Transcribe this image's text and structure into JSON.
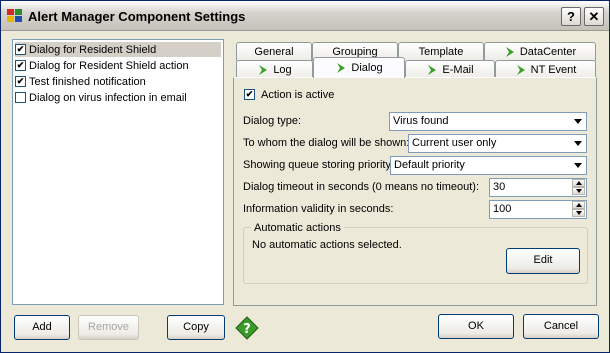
{
  "window": {
    "title": "Alert Manager Component Settings",
    "help_glyph": "?",
    "close_glyph": "✕"
  },
  "left_list": {
    "items": [
      {
        "label": "Dialog for Resident Shield",
        "checked": true,
        "selected": true
      },
      {
        "label": "Dialog for Resident Shield action",
        "checked": true,
        "selected": false
      },
      {
        "label": "Test finished notification",
        "checked": true,
        "selected": false
      },
      {
        "label": "Dialog on virus infection in email",
        "checked": false,
        "selected": false
      }
    ]
  },
  "left_buttons": {
    "add": "Add",
    "remove": "Remove",
    "copy": "Copy"
  },
  "tabs": {
    "row1": [
      "General",
      "Grouping",
      "Template",
      "DataCenter"
    ],
    "row2": [
      "Log",
      "Dialog",
      "E-Mail",
      "NT Event"
    ],
    "active": "Dialog"
  },
  "dialog_tab": {
    "action_active_label": "Action is active",
    "action_active_checked": true,
    "dialog_type_label": "Dialog type:",
    "dialog_type_value": "Virus found",
    "shown_to_label": "To whom the dialog will be shown:",
    "shown_to_value": "Current user only",
    "queue_priority_label": "Showing queue storing priority:",
    "queue_priority_value": "Default priority",
    "timeout_label": "Dialog timeout in seconds (0 means no timeout):",
    "timeout_value": "30",
    "validity_label": "Information validity in seconds:",
    "validity_value": "100",
    "auto_actions_title": "Automatic actions",
    "auto_actions_text": "No automatic actions selected.",
    "edit_button": "Edit"
  },
  "bottom_buttons": {
    "ok": "OK",
    "cancel": "Cancel"
  },
  "icons": {
    "app": "alert-manager-icon",
    "tab_marker": "green-arrow-icon",
    "help": "green-help-icon"
  }
}
